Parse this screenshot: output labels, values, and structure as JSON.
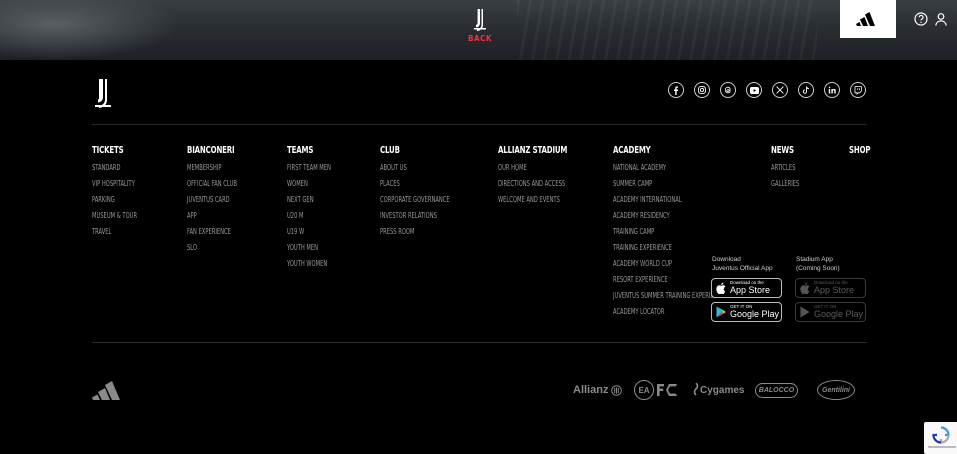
{
  "header": {
    "back_label": "BACK",
    "icons": [
      "juventus-logo-icon",
      "adidas-icon",
      "help-icon",
      "user-icon"
    ]
  },
  "social": [
    "facebook",
    "instagram",
    "threads",
    "youtube",
    "x",
    "tiktok",
    "linkedin",
    "twitch"
  ],
  "columns": [
    {
      "title": "TICKETS",
      "links": [
        "STANDARD",
        "VIP HOSPITALITY",
        "PARKING",
        "MUSEUM & TOUR",
        "TRAVEL"
      ]
    },
    {
      "title": "BIANCONERI",
      "links": [
        "MEMBERSHIP",
        "OFFICIAL FAN CLUB",
        "JUVENTUS CARD",
        "APP",
        "FAN EXPERIENCE",
        "SLO"
      ]
    },
    {
      "title": "TEAMS",
      "links": [
        "FIRST TEAM MEN",
        "WOMEN",
        "NEXT GEN",
        "U20 M",
        "U19 W",
        "YOUTH MEN",
        "YOUTH WOMEN"
      ]
    },
    {
      "title": "CLUB",
      "links": [
        "ABOUT US",
        "PLACES",
        "CORPORATE GOVERNANCE",
        "INVESTOR RELATIONS",
        "PRESS ROOM"
      ]
    },
    {
      "title": "ALLIANZ STADIUM",
      "links": [
        "OUR HOME",
        "DIRECTIONS AND ACCESS",
        "WELCOME AND EVENTS"
      ]
    },
    {
      "title": "ACADEMY",
      "links": [
        "NATIONAL ACADEMY",
        "SUMMER CAMP",
        "ACADEMY INTERNATIONAL",
        "ACADEMY RESIDENCY",
        "TRAINING CAMP",
        "TRAINING EXPERIENCE",
        "ACADEMY WORLD CUP",
        "RESORT EXPERIENCE",
        "JUVENTUS SUMMER TRAINING EXPERIENCE",
        "ACADEMY LOCATOR"
      ]
    },
    {
      "title": "NEWS",
      "links": [
        "ARTICLES",
        "GALLERIES"
      ]
    },
    {
      "title": "SHOP",
      "links": []
    }
  ],
  "apps": {
    "official": {
      "label_line1": "Download",
      "label_line2": "Juventus Official App",
      "appstore_small": "Download on the",
      "appstore_big": "App Store",
      "googleplay_small": "GET IT ON",
      "googleplay_big": "Google Play"
    },
    "stadium": {
      "label_line1": "Stadium App",
      "label_line2": "(Coming Soon)",
      "appstore_small": "Download on the",
      "appstore_big": "App Store",
      "googleplay_small": "GET IT ON",
      "googleplay_big": "Google Play"
    }
  },
  "sponsors": {
    "allianz": "Allianz",
    "ea": "EA",
    "cygames": "Cygames",
    "balocco": "BALOCCO",
    "gentilini": "Gentilini"
  },
  "colors": {
    "back": "#ff2d3d",
    "link": "#9a9a9a",
    "background": "#000000"
  }
}
